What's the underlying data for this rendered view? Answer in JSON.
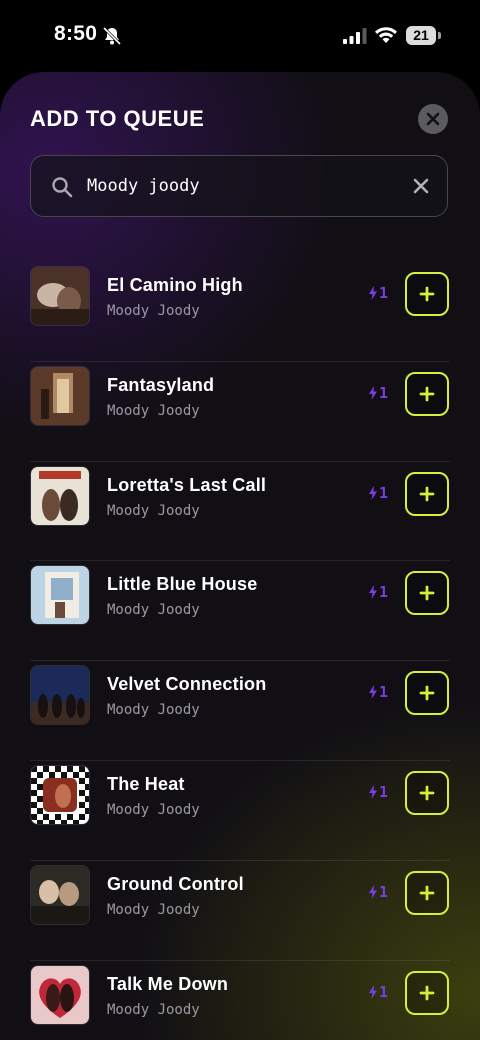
{
  "status_bar": {
    "time": "8:50",
    "battery": "21"
  },
  "header": {
    "title": "ADD TO QUEUE"
  },
  "search": {
    "query": "Moody joody"
  },
  "songs": [
    {
      "title": "El Camino High",
      "artist": "Moody Joody",
      "cost": "1"
    },
    {
      "title": "Fantasyland",
      "artist": "Moody Joody",
      "cost": "1"
    },
    {
      "title": "Loretta's Last Call",
      "artist": "Moody Joody",
      "cost": "1"
    },
    {
      "title": "Little Blue House",
      "artist": "Moody Joody",
      "cost": "1"
    },
    {
      "title": "Velvet Connection",
      "artist": "Moody Joody",
      "cost": "1"
    },
    {
      "title": "The Heat",
      "artist": "Moody Joody",
      "cost": "1"
    },
    {
      "title": "Ground Control",
      "artist": "Moody Joody",
      "cost": "1"
    },
    {
      "title": "Talk Me Down",
      "artist": "Moody Joody",
      "cost": "1"
    }
  ],
  "colors": {
    "accent_green": "#d4f03a",
    "accent_purple": "#7a3ee0",
    "background": "#110f14"
  },
  "icons": {
    "close": "close-icon",
    "search": "search-icon",
    "clear": "clear-icon",
    "add": "plus-icon",
    "cost": "bolt-icon"
  }
}
